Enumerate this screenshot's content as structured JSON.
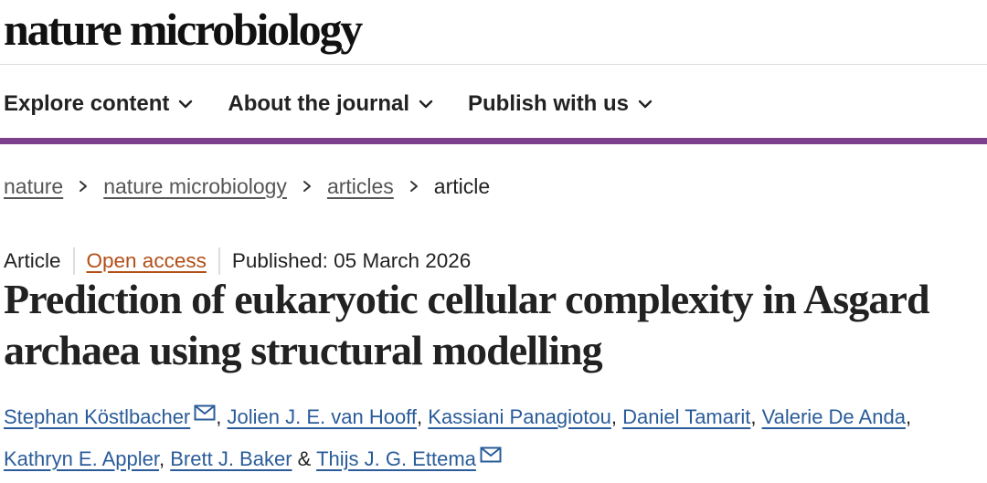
{
  "header": {
    "logo": "nature microbiology"
  },
  "nav": {
    "items": [
      {
        "label": "Explore content",
        "icon": "chevron-down-icon"
      },
      {
        "label": "About the journal",
        "icon": "chevron-down-icon"
      },
      {
        "label": "Publish with us",
        "icon": "chevron-down-icon"
      }
    ]
  },
  "colors": {
    "accent_bar": "#7c3f8c",
    "link": "#2a5c99",
    "open_access": "#b24f17"
  },
  "breadcrumb": {
    "items": [
      "nature",
      "nature microbiology",
      "articles"
    ],
    "current": "article",
    "separator_icon": "chevron-right-icon"
  },
  "article": {
    "type": "Article",
    "open_access": "Open access",
    "published": "Published: 05 March 2026",
    "title": "Prediction of eukaryotic cellular complexity in Asgard archaea using structural modelling",
    "authors": [
      "Stephan Köstlbacher",
      "Jolien J. E. van Hooff",
      "Kassiani Panagiotou",
      "Daniel Tamarit",
      "Valerie De Anda",
      "Kathryn E. Appler",
      "Brett J. Baker",
      "Thijs J. G. Ettema"
    ],
    "comma": ",",
    "ampersand": "&",
    "mail_icon": "mail-icon"
  }
}
